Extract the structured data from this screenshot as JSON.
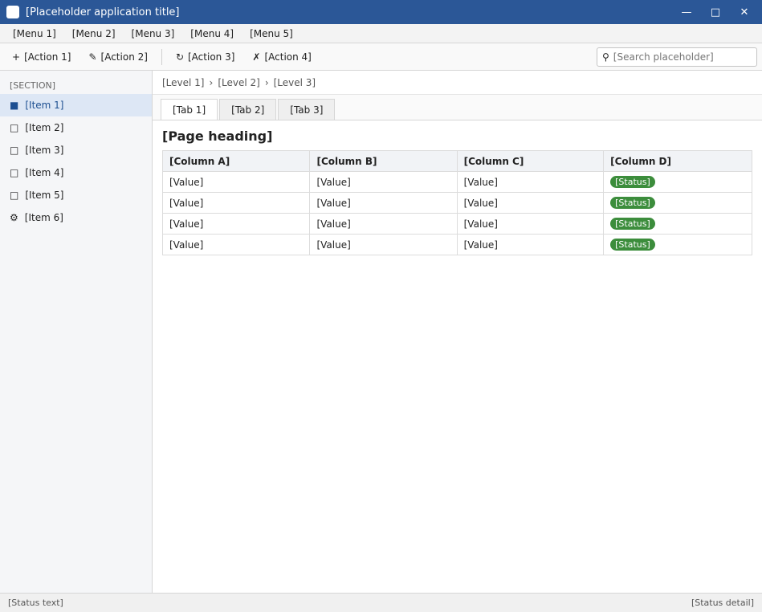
{
  "window": {
    "title": "[Placeholder application title]"
  },
  "menu": [
    "[Menu 1]",
    "[Menu 2]",
    "[Menu 3]",
    "[Menu 4]",
    "[Menu 5]"
  ],
  "toolbar": {
    "buttons": [
      "[Action 1]",
      "[Action 2]",
      "[Action 3]",
      "[Action 4]"
    ],
    "search_placeholder": "[Search placeholder]"
  },
  "sidebar": {
    "section_label": "[Section]",
    "items": [
      "[Item 1]",
      "[Item 2]",
      "[Item 3]",
      "[Item 4]",
      "[Item 5]",
      "[Item 6]"
    ]
  },
  "breadcrumb": [
    "[Level 1]",
    "[Level 2]",
    "[Level 3]"
  ],
  "tabs": [
    "[Tab 1]",
    "[Tab 2]",
    "[Tab 3]"
  ],
  "page": {
    "title": "[Page heading]"
  },
  "table": {
    "columns": [
      "[Column A]",
      "[Column B]",
      "[Column C]",
      "[Column D]"
    ],
    "rows": [
      [
        "[Value]",
        "[Value]",
        "[Value]",
        "[Status]"
      ],
      [
        "[Value]",
        "[Value]",
        "[Value]",
        "[Status]"
      ],
      [
        "[Value]",
        "[Value]",
        "[Value]",
        "[Status]"
      ],
      [
        "[Value]",
        "[Value]",
        "[Value]",
        "[Status]"
      ]
    ]
  },
  "status": {
    "left": "[Status text]",
    "right": "[Status detail]"
  },
  "colors": {
    "accent": "#2b5797",
    "status": "#3c8d3c"
  }
}
